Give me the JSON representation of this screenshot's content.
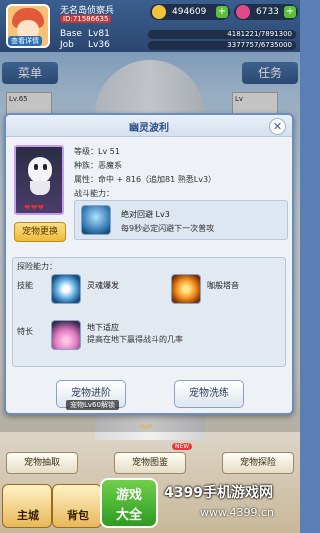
{
  "player": {
    "name": "无名岛侦察兵",
    "id": "ID:71586635",
    "avatar_label": "查看详情",
    "base_label": "Base",
    "base_level": "Lv81",
    "base_exp": "4181221/7891300",
    "job_label": "Job",
    "job_level": "Lv36",
    "job_exp": "3377757/6735000"
  },
  "currency": {
    "zeny": "494609",
    "diamond": "6733",
    "plus": "+"
  },
  "side": {
    "left": "菜单",
    "right": "任务"
  },
  "background_cards": {
    "left_level": "Lv.65",
    "mid_level": "Lv"
  },
  "dialog": {
    "title": "幽灵波利",
    "close": "✕",
    "change_button": "宠物更换",
    "hearts": "❤❤❤",
    "stats": {
      "level": "等级：Lv 51",
      "race": "种族：恶魔系",
      "attribute": "属性：命中 + 816（追加81 熟悉Lv3）",
      "combat_label": "战斗能力："
    },
    "combat_skill": {
      "name": "绝对回避 Lv3",
      "desc": "每9秒必定闪避下一次普攻"
    },
    "explore": {
      "title": "探险能力：",
      "skill_label": "技能",
      "specialty_label": "特长",
      "skill_a": "灵魂爆发",
      "skill_b": "咖般塔音",
      "specialty_name": "地下适应",
      "specialty_desc": "提高在地下赢得战斗的几率"
    },
    "advance_button": "宠物进阶",
    "unlock_note": "宠物Lv60解锁",
    "wash_button": "宠物洗练"
  },
  "bottom": {
    "capture": "宠物抽取",
    "album": "宠物图鉴",
    "explore": "宠物探险",
    "new_badge": "NEW",
    "chevron": "︾"
  },
  "nav": {
    "city": "主城",
    "bag": "背包"
  },
  "watermark": {
    "logo_line1": "游戏",
    "logo_line2": "大全",
    "title": "4399手机游戏网",
    "url": "www.4399.cn"
  }
}
